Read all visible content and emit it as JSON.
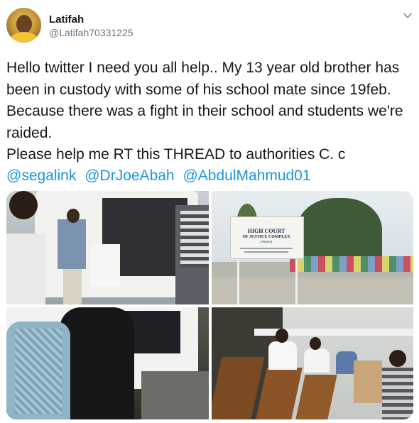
{
  "user": {
    "name": "Latifah",
    "handle": "@Latifah70331225"
  },
  "tweet": {
    "text": "Hello twitter I need you all help.. My 13 year old brother has been in custody with some of his school mate since 19feb. Because there was a fight in their school and students we're raided.\nPlease help me RT this THREAD to authorities C. c",
    "mentions": [
      "@segalink",
      "@DrJoeAbah",
      "@AbdulMahmud01"
    ]
  },
  "media": {
    "sign_line1": "HIGH COURT",
    "sign_line2": "OF JUSTICE COMPLEX",
    "sign_line3": "(Annex)"
  },
  "colors": {
    "link": "#1b95e0",
    "secondary_text": "#657786"
  },
  "icons": [
    "chevron-down-icon"
  ]
}
